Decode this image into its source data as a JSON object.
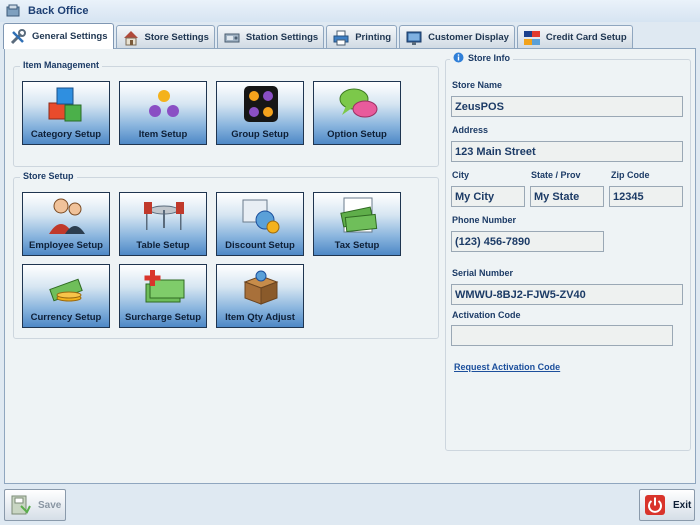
{
  "app": {
    "title": "Back Office"
  },
  "tabs": [
    {
      "label": "General Settings",
      "icon": "tools-icon"
    },
    {
      "label": "Store Settings",
      "icon": "house-icon"
    },
    {
      "label": "Station Settings",
      "icon": "station-icon"
    },
    {
      "label": "Printing",
      "icon": "printer-icon"
    },
    {
      "label": "Customer Display",
      "icon": "monitor-icon"
    },
    {
      "label": "Credit Card Setup",
      "icon": "credit-card-icon"
    }
  ],
  "item_management": {
    "label": "Item Management",
    "buttons": [
      {
        "label": "Category Setup",
        "icon": "cubes-icon"
      },
      {
        "label": "Item Setup",
        "icon": "dots-icon"
      },
      {
        "label": "Group Setup",
        "icon": "group-icon"
      },
      {
        "label": "Option Setup",
        "icon": "chat-bubbles-icon"
      }
    ]
  },
  "store_setup": {
    "label": "Store Setup",
    "buttons": [
      {
        "label": "Employee Setup",
        "icon": "people-icon"
      },
      {
        "label": "Table Setup",
        "icon": "table-chairs-icon"
      },
      {
        "label": "Discount Setup",
        "icon": "discount-icon"
      },
      {
        "label": "Tax Setup",
        "icon": "money-icon"
      },
      {
        "label": "Currency Setup",
        "icon": "currency-icon"
      },
      {
        "label": "Surcharge Setup",
        "icon": "surcharge-icon"
      },
      {
        "label": "Item Qty Adjust",
        "icon": "box-icon"
      }
    ]
  },
  "store_info": {
    "label": "Store Info",
    "store_name_label": "Store Name",
    "store_name": "ZeusPOS",
    "address_label": "Address",
    "address": "123 Main Street",
    "city_label": "City",
    "city": "My City",
    "state_label": "State / Prov",
    "state": "My State",
    "zip_label": "Zip Code",
    "zip": "12345",
    "phone_label": "Phone Number",
    "phone": "(123) 456-7890",
    "serial_label": "Serial Number",
    "serial": "WMWU-8BJ2-FJW5-ZV40",
    "activation_label": "Activation Code",
    "activation": "",
    "request_link": "Request Activation Code"
  },
  "footer": {
    "save_label": "Save",
    "exit_label": "Exit"
  },
  "colors": {
    "accent": "#4e88c6",
    "tile_border": "#1f3550",
    "text": "#1c3b66",
    "exit_red": "#d9342b"
  }
}
